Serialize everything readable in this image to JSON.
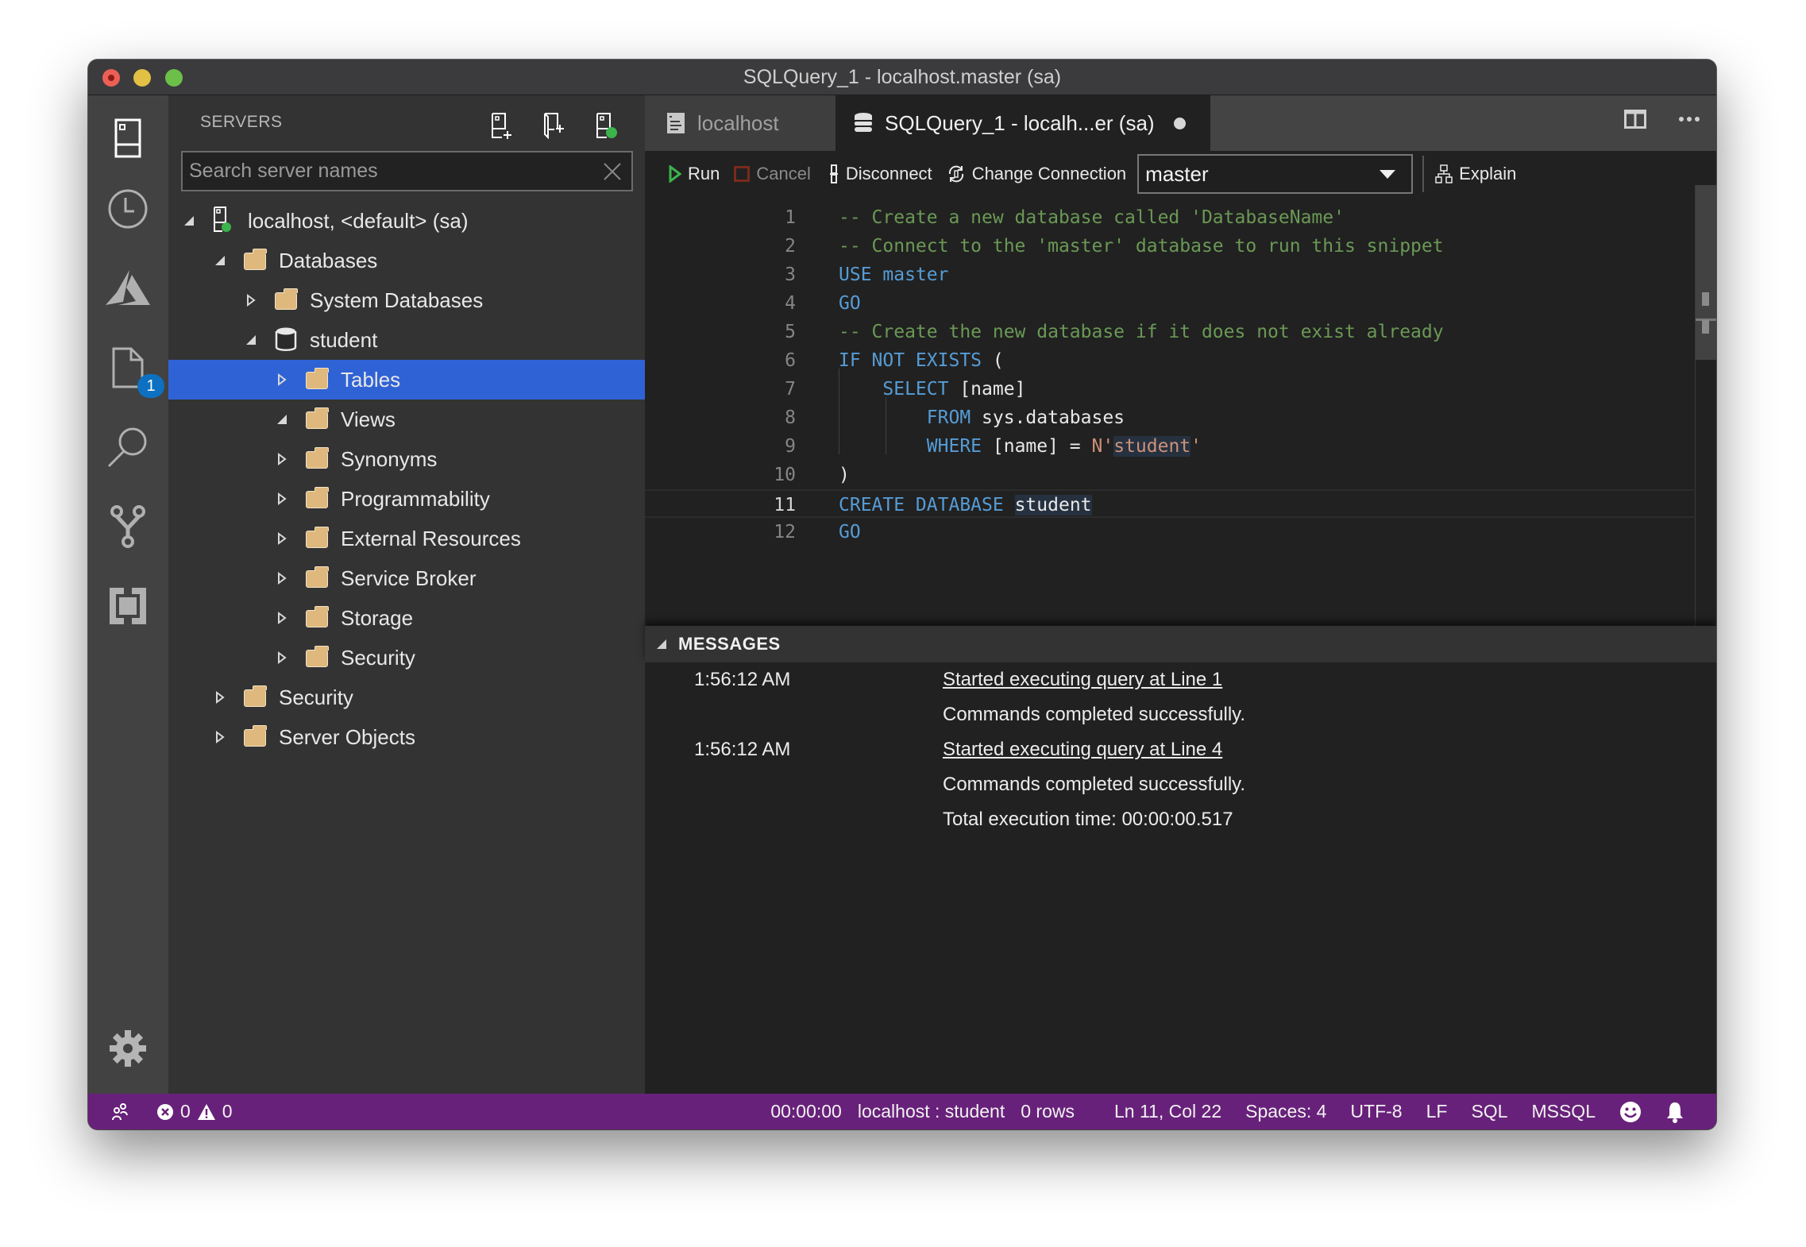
{
  "window": {
    "title": "SQLQuery_1 - localhost.master (sa)"
  },
  "activity_bar": {
    "items": [
      {
        "name": "servers",
        "icon": "server-icon"
      },
      {
        "name": "task-history",
        "icon": "clock-icon"
      },
      {
        "name": "azure",
        "icon": "azure-icon"
      },
      {
        "name": "explorer",
        "icon": "file-icon",
        "badge": "1"
      },
      {
        "name": "search",
        "icon": "search-icon"
      },
      {
        "name": "source-control",
        "icon": "git-branch-icon"
      },
      {
        "name": "extensions",
        "icon": "extensions-icon"
      }
    ],
    "settings_icon": "gear-icon"
  },
  "sidebar": {
    "title": "SERVERS",
    "actions": [
      "new-connection-icon",
      "new-server-group-icon",
      "active-connections-icon"
    ],
    "search": {
      "placeholder": "Search server names",
      "value": ""
    },
    "tree": [
      {
        "label": "localhost, <default> (sa)",
        "depth": 0,
        "state": "expanded",
        "icon": "server-connected"
      },
      {
        "label": "Databases",
        "depth": 1,
        "state": "expanded",
        "icon": "folder"
      },
      {
        "label": "System Databases",
        "depth": 2,
        "state": "collapsed",
        "icon": "folder"
      },
      {
        "label": "student",
        "depth": 2,
        "state": "expanded",
        "icon": "database"
      },
      {
        "label": "Tables",
        "depth": 3,
        "state": "collapsed",
        "icon": "folder",
        "selected": true
      },
      {
        "label": "Views",
        "depth": 3,
        "state": "expanded",
        "icon": "folder"
      },
      {
        "label": "Synonyms",
        "depth": 3,
        "state": "collapsed",
        "icon": "folder"
      },
      {
        "label": "Programmability",
        "depth": 3,
        "state": "collapsed",
        "icon": "folder"
      },
      {
        "label": "External Resources",
        "depth": 3,
        "state": "collapsed",
        "icon": "folder"
      },
      {
        "label": "Service Broker",
        "depth": 3,
        "state": "collapsed",
        "icon": "folder"
      },
      {
        "label": "Storage",
        "depth": 3,
        "state": "collapsed",
        "icon": "folder"
      },
      {
        "label": "Security",
        "depth": 3,
        "state": "collapsed",
        "icon": "folder"
      },
      {
        "label": "Security",
        "depth": 1,
        "state": "collapsed",
        "icon": "folder"
      },
      {
        "label": "Server Objects",
        "depth": 1,
        "state": "collapsed",
        "icon": "folder"
      }
    ]
  },
  "tabs": [
    {
      "label": "localhost",
      "icon": "dashboard-icon",
      "active": false
    },
    {
      "label": "SQLQuery_1 - localh...er (sa)",
      "icon": "database-icon",
      "active": true,
      "dirty": true
    }
  ],
  "tab_actions": [
    "split-editor-icon",
    "more-actions-icon"
  ],
  "toolbar": {
    "run": "Run",
    "cancel": "Cancel",
    "disconnect": "Disconnect",
    "change_connection": "Change Connection",
    "database": "master",
    "explain": "Explain"
  },
  "editor": {
    "current_line": 11,
    "lines": [
      {
        "n": "1",
        "tokens": [
          {
            "t": "-- Create a new database called 'DatabaseName'",
            "c": "cm"
          }
        ]
      },
      {
        "n": "2",
        "tokens": [
          {
            "t": "-- Connect to the 'master' database to run this snippet",
            "c": "cm"
          }
        ]
      },
      {
        "n": "3",
        "tokens": [
          {
            "t": "USE",
            "c": "kw"
          },
          {
            "t": " ",
            "c": "id"
          },
          {
            "t": "master",
            "c": "kw"
          }
        ]
      },
      {
        "n": "4",
        "tokens": [
          {
            "t": "GO",
            "c": "kw"
          }
        ]
      },
      {
        "n": "5",
        "tokens": [
          {
            "t": "-- Create the new database if it does not exist already",
            "c": "cm"
          }
        ]
      },
      {
        "n": "6",
        "tokens": [
          {
            "t": "IF NOT EXISTS",
            "c": "kw"
          },
          {
            "t": " (",
            "c": "id"
          }
        ]
      },
      {
        "n": "7",
        "tokens": [
          {
            "t": "    ",
            "c": "id"
          },
          {
            "t": "SELECT",
            "c": "kw"
          },
          {
            "t": " [name]",
            "c": "id"
          }
        ]
      },
      {
        "n": "8",
        "tokens": [
          {
            "t": "        ",
            "c": "id"
          },
          {
            "t": "FROM",
            "c": "kw"
          },
          {
            "t": " sys.databases",
            "c": "id"
          }
        ]
      },
      {
        "n": "9",
        "tokens": [
          {
            "t": "        ",
            "c": "id"
          },
          {
            "t": "WHERE",
            "c": "kw"
          },
          {
            "t": " [name] = ",
            "c": "id"
          },
          {
            "t": "N'",
            "c": "str"
          },
          {
            "t": "student",
            "c": "str hl"
          },
          {
            "t": "'",
            "c": "str"
          }
        ]
      },
      {
        "n": "10",
        "tokens": [
          {
            "t": ")",
            "c": "id"
          }
        ]
      },
      {
        "n": "11",
        "tokens": [
          {
            "t": "CREATE DATABASE",
            "c": "kw"
          },
          {
            "t": " ",
            "c": "id"
          },
          {
            "t": "student",
            "c": "id hl"
          }
        ]
      },
      {
        "n": "12",
        "tokens": [
          {
            "t": "GO",
            "c": "kw"
          }
        ]
      }
    ]
  },
  "messages_panel": {
    "title": "MESSAGES",
    "rows": [
      {
        "time": "1:56:12 AM",
        "text": "Started executing query at Line 1",
        "link": true
      },
      {
        "time": "",
        "text": "Commands completed successfully.",
        "link": false
      },
      {
        "time": "1:56:12 AM",
        "text": "Started executing query at Line 4",
        "link": true
      },
      {
        "time": "",
        "text": "Commands completed successfully.",
        "link": false
      },
      {
        "time": "",
        "text": "Total execution time: 00:00:00.517",
        "link": false
      }
    ]
  },
  "statusbar": {
    "errors": "0",
    "warnings": "0",
    "elapsed": "00:00:00",
    "connection": "localhost : student",
    "rows": "0 rows",
    "cursor": "Ln 11, Col 22",
    "indent": "Spaces: 4",
    "encoding": "UTF-8",
    "eol": "LF",
    "language": "SQL",
    "provider": "MSSQL",
    "colors": {
      "background": "#68217a"
    }
  }
}
